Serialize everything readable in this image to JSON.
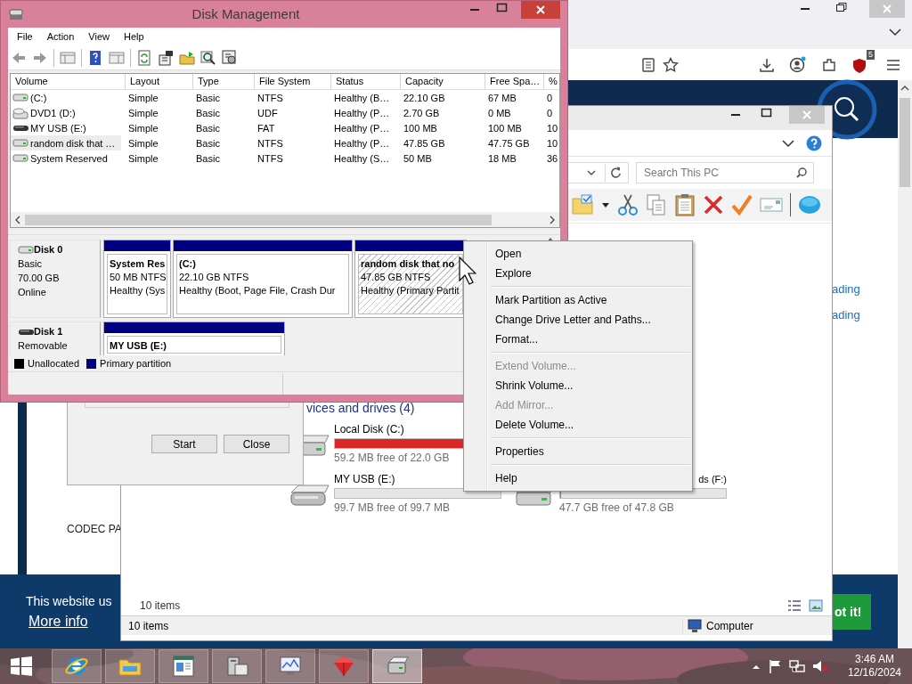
{
  "browser": {
    "extension_badge": "5",
    "page": {
      "side_links": [
        "ading",
        "ading"
      ],
      "list_item": "CODEC PA"
    },
    "cookie_banner": {
      "message": "This website us",
      "link": "More info",
      "button": "ot it!"
    }
  },
  "explorer": {
    "search": {
      "placeholder": "Search This PC"
    },
    "section_title": "vices and drives (4)",
    "drives": [
      {
        "kind": "hdd",
        "name": "Local Disk (C:)",
        "level": 0.997,
        "low_space": true,
        "free": "59.2 MB free of 22.0 GB"
      },
      {
        "kind": "usb",
        "name": "MY USB (E:)",
        "level": 0,
        "free": "99.7 MB free of 99.7 MB"
      },
      {
        "kind": "hdd",
        "name": "ds (F:)",
        "level": 0.002,
        "low_space": false,
        "free": "47.7 GB free of 47.8 GB"
      }
    ],
    "item_count": "10 items",
    "status_bar": {
      "items": "10 items",
      "location": "Computer"
    }
  },
  "format_dialog": {
    "buttons": [
      "Start",
      "Close"
    ]
  },
  "disk_management": {
    "title": "Disk Management",
    "menu": [
      "File",
      "Action",
      "View",
      "Help"
    ],
    "table": {
      "columns": [
        "Volume",
        "Layout",
        "Type",
        "File System",
        "Status",
        "Capacity",
        "Free Spa…",
        "%"
      ],
      "rows": [
        {
          "kind": "hdd",
          "selected": false,
          "cells": [
            "(C:)",
            "Simple",
            "Basic",
            "NTFS",
            "Healthy (B…",
            "22.10 GB",
            "67 MB",
            "0"
          ]
        },
        {
          "kind": "dvd",
          "selected": false,
          "cells": [
            "DVD1 (D:)",
            "Simple",
            "Basic",
            "UDF",
            "Healthy (P…",
            "2.70 GB",
            "0 MB",
            "0"
          ]
        },
        {
          "kind": "usb",
          "selected": false,
          "cells": [
            "MY USB (E:)",
            "Simple",
            "Basic",
            "FAT",
            "Healthy (P…",
            "100 MB",
            "100 MB",
            "10"
          ]
        },
        {
          "kind": "hdd",
          "selected": true,
          "cells": [
            "random disk that …",
            "Simple",
            "Basic",
            "NTFS",
            "Healthy (P…",
            "47.85 GB",
            "47.75 GB",
            "10"
          ]
        },
        {
          "kind": "hdd",
          "selected": false,
          "cells": [
            "System Reserved",
            "Simple",
            "Basic",
            "NTFS",
            "Healthy (S…",
            "50 MB",
            "18 MB",
            "36"
          ]
        }
      ]
    },
    "disks": [
      {
        "kind": "hdd",
        "name": "Disk 0",
        "details": [
          "Basic",
          "70.00 GB",
          "Online"
        ],
        "partitions": [
          {
            "name": "System Res",
            "size": "50 MB NTFS",
            "status": "Healthy (Sys",
            "selected": false
          },
          {
            "name": "(C:)",
            "size": "22.10 GB NTFS",
            "status": "Healthy (Boot, Page File, Crash Dur",
            "selected": false
          },
          {
            "name": "random disk that no",
            "size": "47.85 GB NTFS",
            "status": "Healthy (Primary Partit",
            "selected": true
          }
        ]
      },
      {
        "kind": "usb",
        "name": "Disk 1",
        "details": [
          "Removable"
        ],
        "partitions": [
          {
            "name": "MY USB  (E:)",
            "selected": false
          }
        ]
      }
    ],
    "legend": [
      {
        "label": "Unallocated",
        "color": "#000000"
      },
      {
        "label": "Primary partition",
        "color": "#000080"
      }
    ]
  },
  "context_menu": {
    "groups": [
      [
        {
          "label": "Open",
          "disabled": false
        },
        {
          "label": "Explore",
          "disabled": false
        }
      ],
      [
        {
          "label": "Mark Partition as Active",
          "disabled": false
        },
        {
          "label": "Change Drive Letter and Paths...",
          "disabled": false
        },
        {
          "label": "Format...",
          "disabled": false
        }
      ],
      [
        {
          "label": "Extend Volume...",
          "disabled": true
        },
        {
          "label": "Shrink Volume...",
          "disabled": false
        },
        {
          "label": "Add Mirror...",
          "disabled": true
        },
        {
          "label": "Delete Volume...",
          "disabled": false
        }
      ],
      [
        {
          "label": "Properties",
          "disabled": false
        }
      ],
      [
        {
          "label": "Help",
          "disabled": false
        }
      ]
    ]
  },
  "taskbar": {
    "apps": [
      {
        "kind": "browser",
        "selected": false
      },
      {
        "kind": "folder",
        "selected": false
      },
      {
        "kind": "window",
        "selected": false
      },
      {
        "kind": "computer",
        "selected": false
      },
      {
        "kind": "monitor",
        "selected": false
      },
      {
        "kind": "cube",
        "selected": false
      },
      {
        "kind": "drive",
        "selected": true
      }
    ],
    "clock": {
      "time": "3:46 AM",
      "date": "12/16/2024"
    }
  }
}
